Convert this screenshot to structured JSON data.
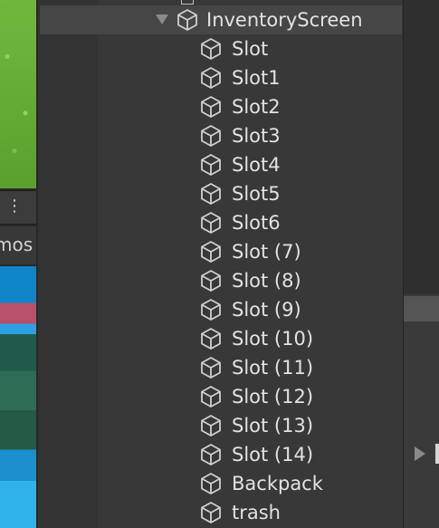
{
  "scene_toolbar": {
    "menu_glyph": "⋮",
    "gizmos_label": "mos"
  },
  "hierarchy": {
    "parent": {
      "label": "InventoryScreen",
      "icon": "cube-icon",
      "expanded": true
    },
    "children": [
      {
        "label": "Slot"
      },
      {
        "label": "Slot1"
      },
      {
        "label": "Slot2"
      },
      {
        "label": "Slot3"
      },
      {
        "label": "Slot4"
      },
      {
        "label": "Slot5"
      },
      {
        "label": "Slot6"
      },
      {
        "label": "Slot (7)"
      },
      {
        "label": "Slot (8)"
      },
      {
        "label": "Slot (9)"
      },
      {
        "label": "Slot (10)"
      },
      {
        "label": "Slot (11)"
      },
      {
        "label": "Slot (12)"
      },
      {
        "label": "Slot (13)"
      },
      {
        "label": "Slot (14)"
      },
      {
        "label": "Backpack"
      },
      {
        "label": "trash"
      }
    ]
  },
  "colors": {
    "panel_bg": "#383838",
    "text": "#e2e2e2",
    "selected_row": "#464646"
  }
}
